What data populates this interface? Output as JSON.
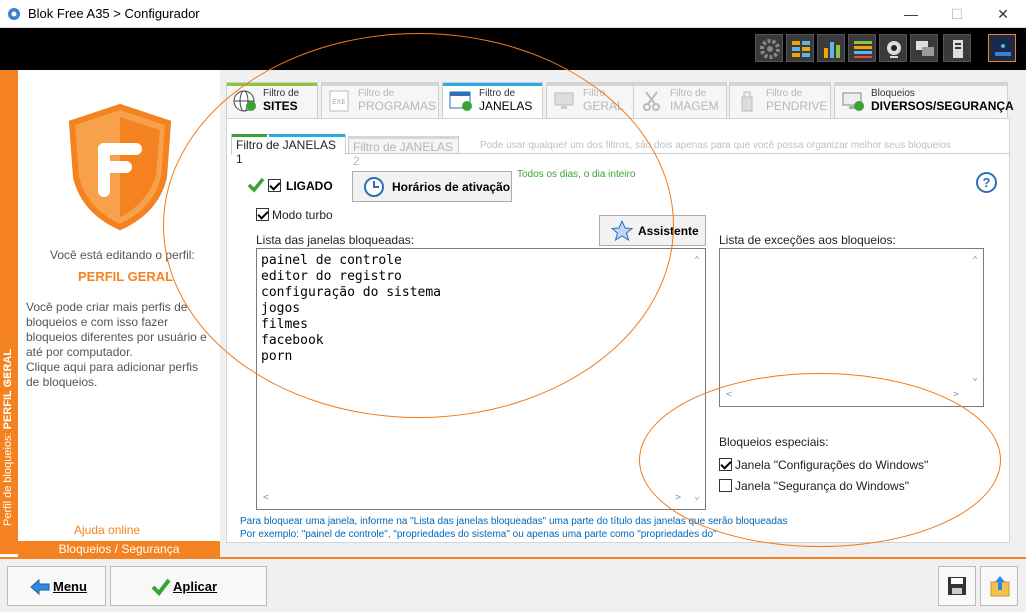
{
  "window": {
    "title": "Blok Free A35 > Configurador",
    "controls": {
      "minimize": "—",
      "maximize": "☐",
      "close": "✕"
    }
  },
  "toolbar_icons": [
    "gear-icon",
    "grid-icon",
    "bar-chart-icon",
    "list-icon",
    "webcam-icon",
    "chat-icon",
    "device-icon",
    "info-icon"
  ],
  "left_panel": {
    "editing_label": "Você está editando o perfil:",
    "profile_name": "PERFIL GERAL",
    "description": [
      "Você pode criar mais perfis de",
      "bloqueios e com isso fazer",
      "bloqueios diferentes por usuário e",
      "até por computador.",
      "Clique aqui para adicionar perfis",
      "de bloqueios."
    ],
    "help_link": "Ajuda online",
    "bottom_tab": "Bloqueios / Segurança",
    "vertical_strip": {
      "prefix": "Perfil de bloqueios:",
      "profile": "PERFIL GERAL"
    }
  },
  "filter_tabs": [
    {
      "line1": "Filtro de",
      "line2": "SITES",
      "color": "#8cc63f",
      "enabled": true,
      "active": false
    },
    {
      "line1": "Filtro de",
      "line2": "PROGRAMAS",
      "color": "#d6d6d6",
      "enabled": false,
      "active": false
    },
    {
      "line1": "Filtro de",
      "line2": "JANELAS",
      "color": "#29abe2",
      "enabled": true,
      "active": true
    },
    {
      "line1": "Filtro",
      "line2": "GERAL",
      "color": "#d6d6d6",
      "enabled": false,
      "active": false
    },
    {
      "line1": "Filtro de",
      "line2": "IMAGEM",
      "color": "#d6d6d6",
      "enabled": false,
      "active": false
    },
    {
      "line1": "Filtro de",
      "line2": "PENDRIVE",
      "color": "#d6d6d6",
      "enabled": false,
      "active": false
    },
    {
      "line1": "Bloqueios",
      "line2": "DIVERSOS/SEGURANÇA",
      "color": "#d6d6d6",
      "enabled": true,
      "active": false
    }
  ],
  "sub_tabs": [
    {
      "label": "Filtro de JANELAS 1",
      "active": true
    },
    {
      "label": "Filtro de JANELAS 2",
      "active": false
    }
  ],
  "sub_tabs_hint": "Pode usar qualquer um dos filtros, são dois apenas para que você possa organizar melhor seus bloqueios",
  "controls": {
    "ligado_label": "LIGADO",
    "ligado_checked": true,
    "schedule_button": "Horários de ativação",
    "schedule_status": "Todos os dias, o dia inteiro",
    "turbo_label": "Modo turbo",
    "turbo_checked": true,
    "assistant_button": "Assistente",
    "help_symbol": "?"
  },
  "blocked_list": {
    "label": "Lista das janelas bloqueadas:",
    "items": [
      "painel de controle",
      "editor do registro",
      "configuração do sistema",
      "jogos",
      "filmes",
      "facebook",
      "porn"
    ]
  },
  "exceptions_list": {
    "label": "Lista de exceções aos bloqueios:",
    "items": []
  },
  "special_blocks": {
    "label": "Bloqueios especiais:",
    "items": [
      {
        "label": "Janela \"Configurações do Windows\"",
        "checked": true
      },
      {
        "label": "Janela \"Segurança do Windows\"",
        "checked": false
      }
    ]
  },
  "notes": [
    "Para bloquear uma janela, informe na \"Lista das janelas bloqueadas\" uma parte do título das janelas que serão bloqueadas",
    "Por exemplo: \"painel de controle\", \"propriedades do sistema\" ou apenas uma parte como \"propriedades do\""
  ],
  "bottom_buttons": {
    "menu": "Menu",
    "apply": "Aplicar"
  },
  "colors": {
    "accent_orange": "#f58220",
    "annotation_orange": "#f07a1a",
    "blue_note": "#0067b8",
    "green_status": "#3aa335"
  }
}
